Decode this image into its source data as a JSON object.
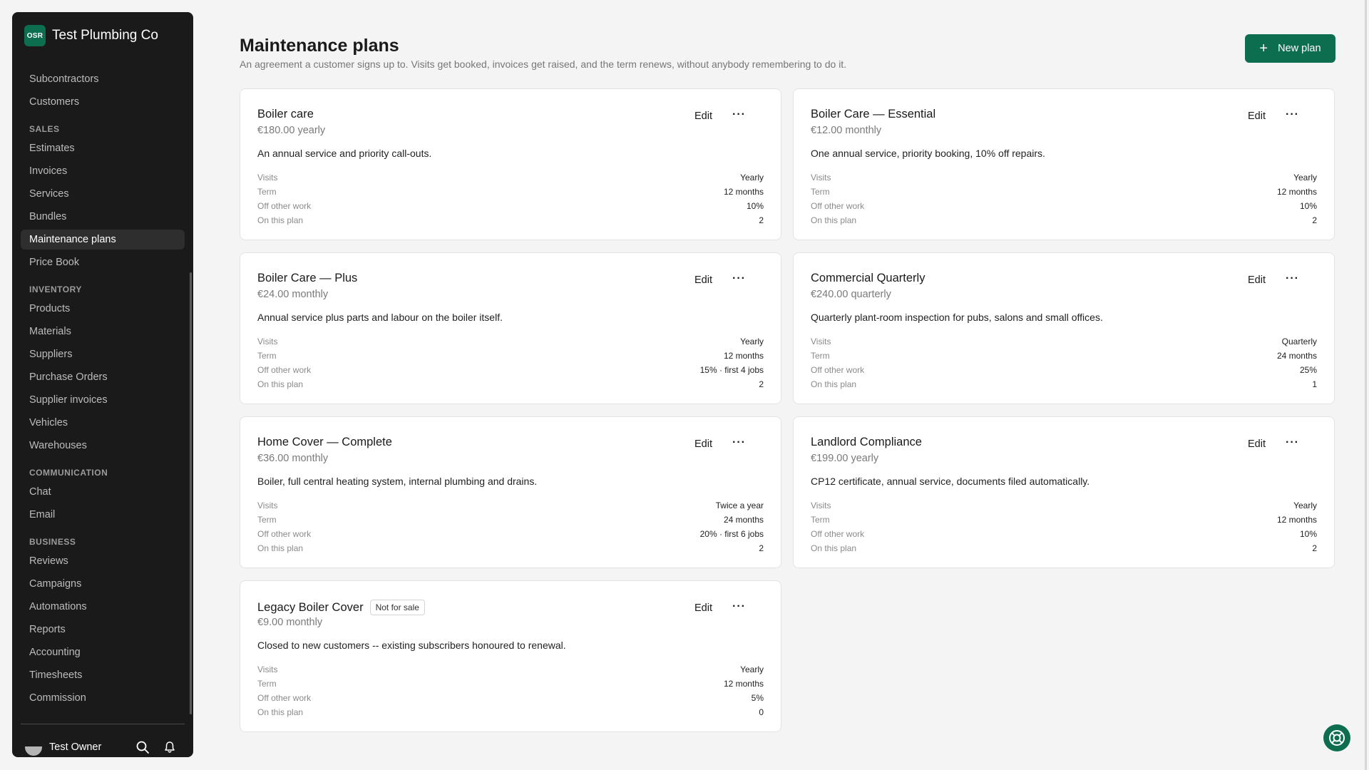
{
  "brand": {
    "logo_text": "OSR",
    "name": "Test Plumbing Co"
  },
  "nav": {
    "top": [
      {
        "label": "Subcontractors"
      },
      {
        "label": "Customers"
      }
    ],
    "sales": {
      "heading": "SALES",
      "items": [
        {
          "label": "Estimates"
        },
        {
          "label": "Invoices"
        },
        {
          "label": "Services"
        },
        {
          "label": "Bundles"
        },
        {
          "label": "Maintenance plans",
          "active": true
        },
        {
          "label": "Price Book"
        }
      ]
    },
    "inventory": {
      "heading": "INVENTORY",
      "items": [
        {
          "label": "Products"
        },
        {
          "label": "Materials"
        },
        {
          "label": "Suppliers"
        },
        {
          "label": "Purchase Orders"
        },
        {
          "label": "Supplier invoices"
        },
        {
          "label": "Vehicles"
        },
        {
          "label": "Warehouses"
        }
      ]
    },
    "communication": {
      "heading": "COMMUNICATION",
      "items": [
        {
          "label": "Chat"
        },
        {
          "label": "Email"
        }
      ]
    },
    "business": {
      "heading": "BUSINESS",
      "items": [
        {
          "label": "Reviews"
        },
        {
          "label": "Campaigns"
        },
        {
          "label": "Automations"
        },
        {
          "label": "Reports"
        },
        {
          "label": "Accounting"
        },
        {
          "label": "Timesheets"
        },
        {
          "label": "Commission"
        }
      ]
    }
  },
  "user": {
    "name": "Test Owner",
    "icons": [
      "search-icon",
      "bell-icon"
    ]
  },
  "header": {
    "title": "Maintenance plans",
    "subtitle": "An agreement a customer signs up to. Visits get booked, invoices get raised, and the term renews, without anybody remembering to do it.",
    "new_plan_label": "New plan",
    "new_plan_icon": "plus-icon"
  },
  "card_labels": {
    "edit": "Edit",
    "more": "···",
    "visits": "Visits",
    "term": "Term",
    "off_other_work": "Off other work",
    "on_this_plan": "On this plan"
  },
  "plans": [
    {
      "name": "Boiler care",
      "badge": "",
      "price": "€180.00 yearly",
      "description": "An annual service and priority call-outs.",
      "visits": "Yearly",
      "term": "12 months",
      "off_other_work": "10%",
      "on_this_plan": "2"
    },
    {
      "name": "Boiler Care — Essential",
      "badge": "",
      "price": "€12.00 monthly",
      "description": "One annual service, priority booking, 10% off repairs.",
      "visits": "Yearly",
      "term": "12 months",
      "off_other_work": "10%",
      "on_this_plan": "2"
    },
    {
      "name": "Boiler Care — Plus",
      "badge": "",
      "price": "€24.00 monthly",
      "description": "Annual service plus parts and labour on the boiler itself.",
      "visits": "Yearly",
      "term": "12 months",
      "off_other_work": "15% · first 4 jobs",
      "on_this_plan": "2"
    },
    {
      "name": "Commercial Quarterly",
      "badge": "",
      "price": "€240.00 quarterly",
      "description": "Quarterly plant-room inspection for pubs, salons and small offices.",
      "visits": "Quarterly",
      "term": "24 months",
      "off_other_work": "25%",
      "on_this_plan": "1"
    },
    {
      "name": "Home Cover — Complete",
      "badge": "",
      "price": "€36.00 monthly",
      "description": "Boiler, full central heating system, internal plumbing and drains.",
      "visits": "Twice a year",
      "term": "24 months",
      "off_other_work": "20% · first 6 jobs",
      "on_this_plan": "2"
    },
    {
      "name": "Landlord Compliance",
      "badge": "",
      "price": "€199.00 yearly",
      "description": "CP12 certificate, annual service, documents filed automatically.",
      "visits": "Yearly",
      "term": "12 months",
      "off_other_work": "10%",
      "on_this_plan": "2"
    },
    {
      "name": "Legacy Boiler Cover",
      "badge": "Not for sale",
      "price": "€9.00 monthly",
      "description": "Closed to new customers -- existing subscribers honoured to renewal.",
      "visits": "Yearly",
      "term": "12 months",
      "off_other_work": "5%",
      "on_this_plan": "0"
    }
  ],
  "help": {
    "icon": "lifebuoy-icon"
  },
  "colors": {
    "accent": "#0d6e4f",
    "sidebar": "#1a1a1a",
    "background": "#f4f4f4"
  }
}
